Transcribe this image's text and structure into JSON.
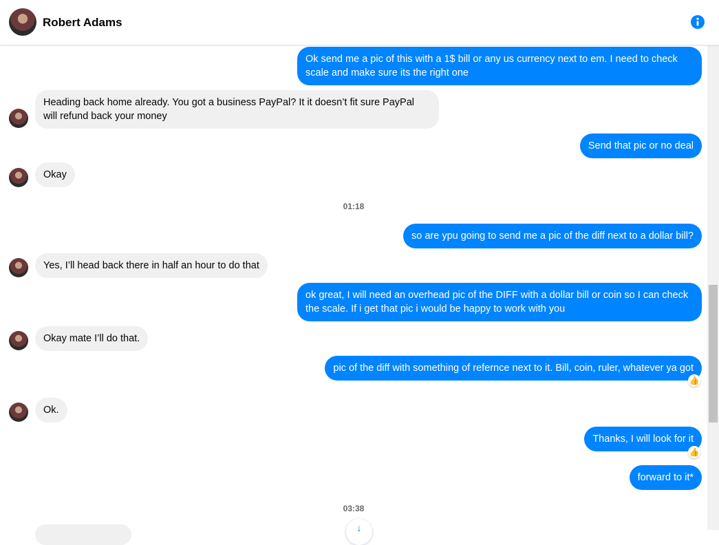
{
  "header": {
    "contact_name": "Robert Adams",
    "info_icon": "info-icon"
  },
  "messages": [
    {
      "dir": "out",
      "text": "Ok send me a pic of this with a 1$ bill or any us currency next to em. I need to check scale and make sure its the right one"
    },
    {
      "dir": "in",
      "text": "Heading back home already. You got a business PayPal? It it doesn’t fit sure PayPal will refund back your money"
    },
    {
      "dir": "out",
      "text": "Send that pic or no deal"
    },
    {
      "dir": "in",
      "text": "Okay"
    },
    {
      "type": "timestamp",
      "text": "01:18"
    },
    {
      "dir": "out",
      "text": "so are ypu going to send me a pic of the diff next to a dollar bill?"
    },
    {
      "dir": "in",
      "text": "Yes, I’ll head back there in half an hour to do that"
    },
    {
      "dir": "out",
      "text": "ok great, I will need an overhead pic of the DIFF with a dollar bill or coin so I can check the scale. If i get that pic i would be happy to work with you"
    },
    {
      "dir": "in",
      "text": "Okay mate I’ll do that."
    },
    {
      "dir": "out",
      "text": "pic of the diff with something of refernce next to it. Bill, coin, ruler, whatever ya got",
      "reaction": "👍"
    },
    {
      "dir": "in",
      "text": "Ok."
    },
    {
      "dir": "out",
      "text": "Thanks, I will look for it",
      "reaction": "👍"
    },
    {
      "dir": "out",
      "text": "forward to it*"
    },
    {
      "type": "timestamp",
      "text": "03:38"
    }
  ],
  "colors": {
    "outgoing": "#0084ff",
    "incoming": "#f0f0f0",
    "accent": "#0084ff"
  }
}
